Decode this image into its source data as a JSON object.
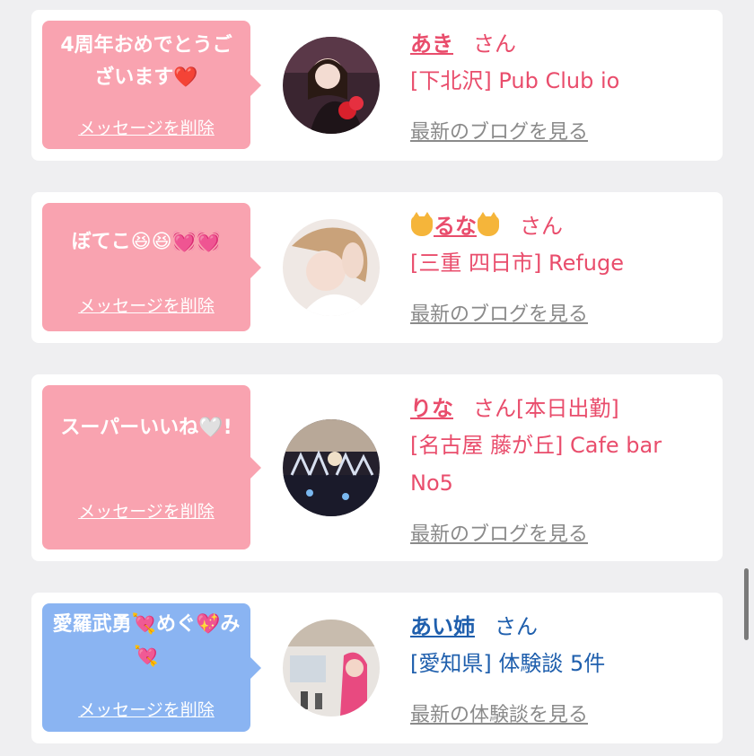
{
  "cards": [
    {
      "message": "4周年おめでとうございます❤️",
      "delete_label": "メッセージを削除",
      "name": "あき",
      "suffix": "さん",
      "shop": "[下北沢] Pub Club io",
      "more_label": "最新のブログを見る"
    },
    {
      "message": "ぼてこ😆😆💓💓",
      "delete_label": "メッセージを削除",
      "name": "るな",
      "suffix": "さん",
      "shop": "[三重 四日市] Refuge",
      "more_label": "最新のブログを見る"
    },
    {
      "message": "スーパーいいね🤍!",
      "delete_label": "メッセージを削除",
      "name": "りな",
      "suffix": "さん[本日出勤]",
      "shop": "[名古屋 藤が丘] Cafe bar No5",
      "more_label": "最新のブログを見る"
    },
    {
      "message": "愛羅武勇💘めぐ💖み💘",
      "delete_label": "メッセージを削除",
      "name": "あい姉",
      "suffix": "さん",
      "shop": "[愛知県] 体験談 5件",
      "more_label": "最新の体験談を見る"
    }
  ]
}
